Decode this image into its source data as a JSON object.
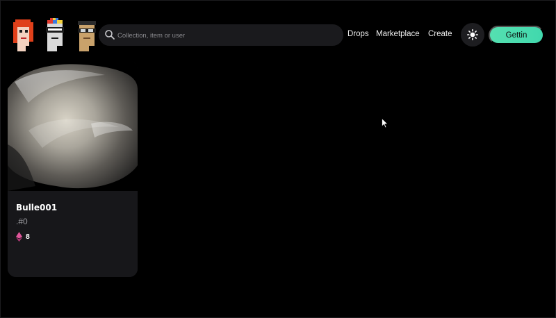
{
  "header": {
    "search": {
      "placeholder": "Collection, item or user"
    },
    "nav": [
      {
        "label": "Drops"
      },
      {
        "label": "Marketplace"
      },
      {
        "label": "Create"
      }
    ],
    "theme_icon": "sun-icon",
    "cta_label": "Gettin"
  },
  "logo_icon": "pixel-avatars-logo",
  "cards": [
    {
      "title": "Bulle001",
      "subtitle": ".#0",
      "price": "8",
      "currency_icon": "ethereum-icon"
    }
  ],
  "colors": {
    "background": "#000000",
    "accent": "#4ADDB0",
    "card": "#17171A",
    "search_bg": "#1A1A1D",
    "eth_pink": "#E0559A"
  }
}
